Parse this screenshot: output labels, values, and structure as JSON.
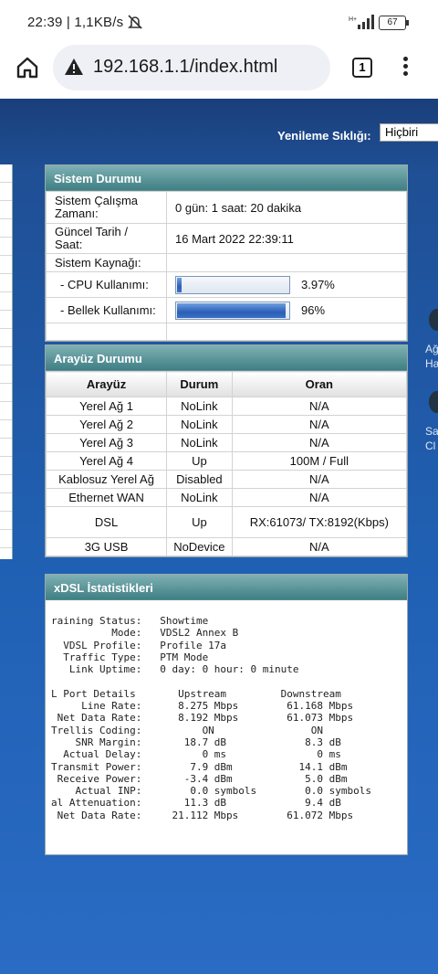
{
  "status_bar": {
    "time": "22:39 | 1,1KB/s",
    "battery": "67",
    "signal_label": "H+"
  },
  "browser": {
    "url": "192.168.1.1/index.html",
    "tab_count": "1"
  },
  "page": {
    "refresh_label": "Yenileme Sıklığı:",
    "refresh_value": "Hiçbiri",
    "side_text_1a": "Ağ",
    "side_text_1b": "Ha",
    "side_text_2a": "Sa",
    "side_text_2b": "Cl"
  },
  "system": {
    "title": "Sistem Durumu",
    "uptime_label": "Sistem Çalışma Zamanı:",
    "uptime_value": "0 gün: 1 saat: 20 dakika",
    "datetime_label": "Güncel Tarih / Saat:",
    "datetime_value": "16 Mart 2022 22:39:11",
    "resource_label": "Sistem Kaynağı:",
    "cpu_label": "- CPU Kullanımı:",
    "cpu_value": "3.97%",
    "cpu_fraction": 0.0397,
    "mem_label": "- Bellek Kullanımı:",
    "mem_value": "96%",
    "mem_fraction": 0.96
  },
  "interfaces": {
    "title": "Arayüz Durumu",
    "headers": [
      "Arayüz",
      "Durum",
      "Oran"
    ],
    "rows": [
      [
        "Yerel Ağ 1",
        "NoLink",
        "N/A"
      ],
      [
        "Yerel Ağ 2",
        "NoLink",
        "N/A"
      ],
      [
        "Yerel Ağ 3",
        "NoLink",
        "N/A"
      ],
      [
        "Yerel Ağ 4",
        "Up",
        "100M / Full"
      ],
      [
        "Kablosuz Yerel Ağ",
        "Disabled",
        "N/A"
      ],
      [
        "Ethernet WAN",
        "NoLink",
        "N/A"
      ],
      [
        "DSL",
        "Up",
        "RX:61073/ TX:8192(Kbps)"
      ],
      [
        "3G USB",
        "NoDevice",
        "N/A"
      ]
    ]
  },
  "xdsl": {
    "title": "xDSL İstatistikleri",
    "text": "raining Status:   Showtime\n          Mode:   VDSL2 Annex B\n  VDSL Profile:   Profile 17a\n  Traffic Type:   PTM Mode\n   Link Uptime:   0 day: 0 hour: 0 minute\n\nL Port Details       Upstream         Downstream\n     Line Rate:      8.275 Mbps        61.168 Mbps\n Net Data Rate:      8.192 Mbps        61.073 Mbps\nTrellis Coding:          ON                ON\n    SNR Margin:       18.7 dB             8.3 dB\n  Actual Delay:          0 ms               0 ms\nTransmit Power:        7.9 dBm           14.1 dBm\n Receive Power:       -3.4 dBm            5.0 dBm\n    Actual INP:        0.0 symbols        0.0 symbols\nal Attenuation:       11.3 dB             9.4 dB\n Net Data Rate:     21.112 Mbps        61.072 Mbps"
  }
}
